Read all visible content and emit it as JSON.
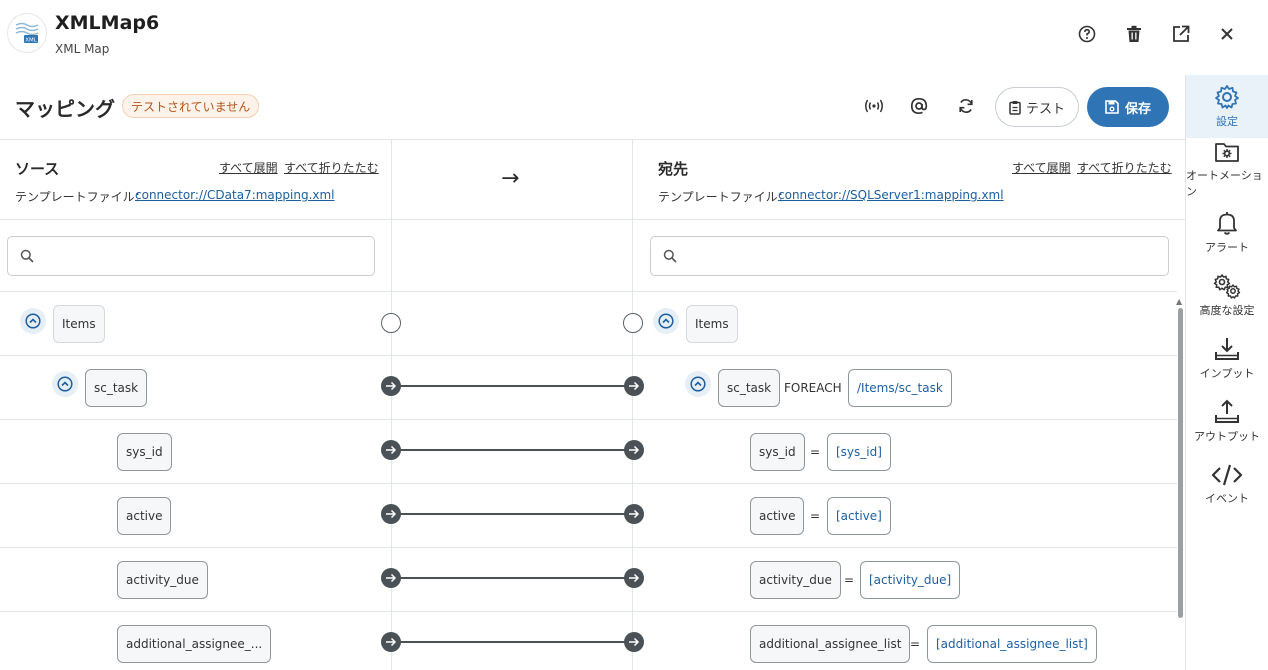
{
  "header": {
    "title": "XMLMap6",
    "subtitle": "XML Map",
    "logo_text": "XML"
  },
  "toolbar": {
    "section_title": "マッピング",
    "status_badge": "テストされていません",
    "test_label": "テスト",
    "save_label": "保存"
  },
  "source": {
    "title": "ソース",
    "expand_all": "すべて展開",
    "collapse_all": "すべて折りたたむ",
    "template_label": "テンプレートファイル：",
    "template_link": "connector://CData7:mapping.xml",
    "search_placeholder": ""
  },
  "middle": {
    "arrow": "→"
  },
  "destination": {
    "title": "宛先",
    "expand_all": "すべて展開",
    "collapse_all": "すべて折りたたむ",
    "template_label": "テンプレートファイル：",
    "template_link": "connector://SQLServer1:mapping.xml",
    "search_placeholder": ""
  },
  "rows": [
    {
      "source": "Items",
      "dest": "Items",
      "dest_value": "",
      "foreach": "",
      "mapped": false
    },
    {
      "source": "sc_task",
      "dest": "sc_task",
      "dest_value": "/Items/sc_task",
      "foreach": "FOREACH",
      "mapped": true
    },
    {
      "source": "sys_id",
      "dest": "sys_id",
      "dest_value": "[sys_id]",
      "foreach": "",
      "mapped": true
    },
    {
      "source": "active",
      "dest": "active",
      "dest_value": "[active]",
      "foreach": "",
      "mapped": true
    },
    {
      "source": "activity_due",
      "dest": "activity_due",
      "dest_value": "[activity_due]",
      "foreach": "",
      "mapped": true
    },
    {
      "source": "additional_assignee_...",
      "dest": "additional_assignee_list",
      "dest_value": "[additional_assignee_list]",
      "foreach": "",
      "mapped": true
    }
  ],
  "equals_sign": "=",
  "sidebar": {
    "items": [
      {
        "label": "設定",
        "icon": "gear-icon"
      },
      {
        "label": "オートメーション",
        "icon": "folder-gear-icon"
      },
      {
        "label": "アラート",
        "icon": "bell-icon"
      },
      {
        "label": "高度な設定",
        "icon": "gears-icon"
      },
      {
        "label": "インプット",
        "icon": "download-icon"
      },
      {
        "label": "アウトプット",
        "icon": "upload-icon"
      },
      {
        "label": "イベント",
        "icon": "code-icon"
      }
    ]
  },
  "colors": {
    "accent": "#2f74b5",
    "badge_text": "#b4561b",
    "badge_bg": "#fdf3ea",
    "link": "#1d5fa0"
  }
}
